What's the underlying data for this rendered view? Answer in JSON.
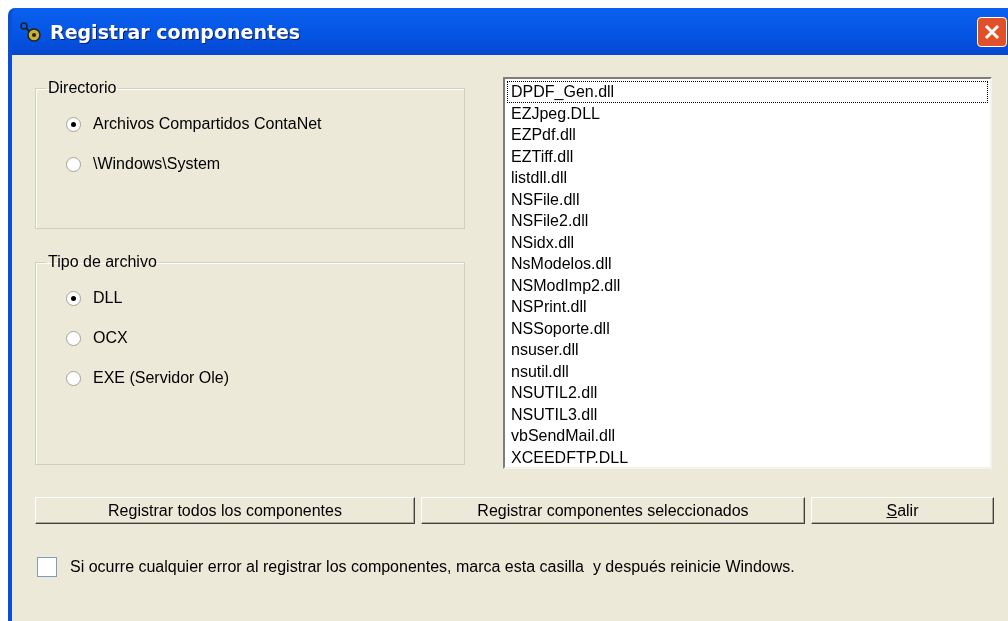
{
  "window": {
    "title": "Registrar componentes"
  },
  "directory_group": {
    "label": "Directorio",
    "options": [
      {
        "label": "Archivos Compartidos ContaNet",
        "selected": true
      },
      {
        "label": "\\Windows\\System",
        "selected": false
      }
    ]
  },
  "file_type_group": {
    "label": "Tipo de archivo",
    "options": [
      {
        "label": "DLL",
        "selected": true
      },
      {
        "label": "OCX",
        "selected": false
      },
      {
        "label": "EXE (Servidor Ole)",
        "selected": false
      }
    ]
  },
  "file_list": {
    "items": [
      {
        "label": "DPDF_Gen.dll",
        "focused": true
      },
      {
        "label": "EZJpeg.DLL",
        "focused": false
      },
      {
        "label": "EZPdf.dll",
        "focused": false
      },
      {
        "label": "EZTiff.dll",
        "focused": false
      },
      {
        "label": "listdll.dll",
        "focused": false
      },
      {
        "label": "NSFile.dll",
        "focused": false
      },
      {
        "label": "NSFile2.dll",
        "focused": false
      },
      {
        "label": "NSidx.dll",
        "focused": false
      },
      {
        "label": "NsModelos.dll",
        "focused": false
      },
      {
        "label": "NSModImp2.dll",
        "focused": false
      },
      {
        "label": "NSPrint.dll",
        "focused": false
      },
      {
        "label": "NSSoporte.dll",
        "focused": false
      },
      {
        "label": "nsuser.dll",
        "focused": false
      },
      {
        "label": "nsutil.dll",
        "focused": false
      },
      {
        "label": "NSUTIL2.dll",
        "focused": false
      },
      {
        "label": "NSUTIL3.dll",
        "focused": false
      },
      {
        "label": "vbSendMail.dll",
        "focused": false
      },
      {
        "label": "XCEEDFTP.DLL",
        "focused": false
      }
    ]
  },
  "buttons": [
    {
      "label": "Registrar todos los componentes",
      "mnemonic": false
    },
    {
      "label": "Registrar componentes seleccionados",
      "mnemonic": false
    },
    {
      "label": "Salir",
      "mnemonic": true
    }
  ],
  "restart_checkbox": {
    "label": "Si ocurre cualquier error al registrar los componentes, marca esta casilla  y después reinicie Windows.",
    "checked": false
  }
}
